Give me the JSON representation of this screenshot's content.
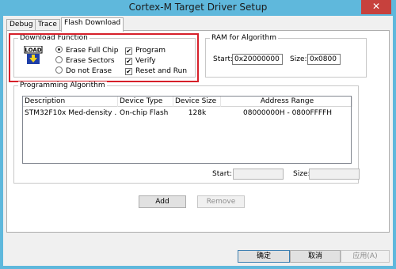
{
  "window": {
    "title": "Cortex-M Target Driver Setup",
    "close_glyph": "✕"
  },
  "tabs": [
    {
      "label": "Debug"
    },
    {
      "label": "Trace"
    },
    {
      "label": "Flash Download"
    }
  ],
  "download_function": {
    "label": "Download Function",
    "icon": "load-icon",
    "icon_text": "LOAD",
    "radios": [
      {
        "label": "Erase Full Chip",
        "selected": true
      },
      {
        "label": "Erase Sectors",
        "selected": false
      },
      {
        "label": "Do not Erase",
        "selected": false
      }
    ],
    "checks": [
      {
        "label": "Program",
        "checked": true
      },
      {
        "label": "Verify",
        "checked": true
      },
      {
        "label": "Reset and Run",
        "checked": true
      }
    ]
  },
  "ram": {
    "label": "RAM for Algorithm",
    "start_label": "Start:",
    "start_value": "0x20000000",
    "size_label": "Size:",
    "size_value": "0x0800"
  },
  "programming": {
    "label": "Programming Algorithm",
    "columns": [
      "Description",
      "Device Type",
      "Device Size",
      "Address Range"
    ],
    "rows": [
      [
        "STM32F10x Med-density ...",
        "On-chip Flash",
        "128k",
        "08000000H - 0800FFFFH"
      ]
    ],
    "start_label": "Start:",
    "start_value": "",
    "size_label": "Size:",
    "size_value": "",
    "add_label": "Add",
    "remove_label": "Remove"
  },
  "footer": {
    "ok_label": "确定",
    "cancel_label": "取消",
    "apply_label": "应用(A)"
  },
  "colors": {
    "highlight": "#d6202a",
    "titlebar": "#5fb8dc",
    "close": "#c7413d"
  }
}
